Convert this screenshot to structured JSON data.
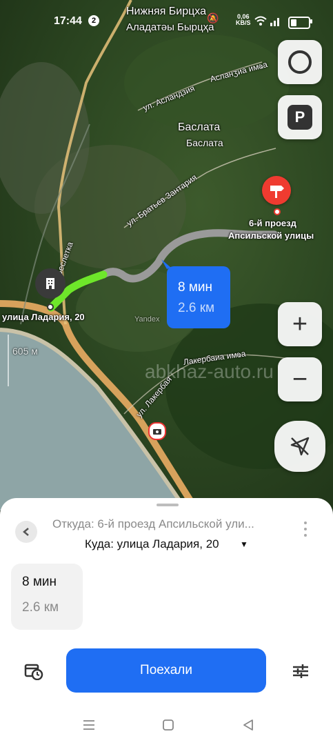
{
  "status_bar": {
    "time": "17:44",
    "notification_count": "2",
    "speed_value": "0,06",
    "speed_unit": "KB/S"
  },
  "map": {
    "place_top_ru": "Нижняя Бирцха",
    "place_top_ab": "Аладатәы Бырцҳа",
    "village_ru": "Баслата",
    "village_ab": "Баслата",
    "street_aslandzia": "ул. Асландзия",
    "street_aslandzia_ab": "Асланӡиа имҩа",
    "street_brothers": "ул. Братьев Зантария",
    "river_besletka": "р. Беслетка",
    "street_lakerbaia": "ул. Лакербая",
    "street_lakerbaia_ab": "Лакербаиа имҩа",
    "yandex_label": "Yandex",
    "watermark": "abkhaz-auto.ru",
    "scale_label": "605 м",
    "destination_label_1": "6-й проезд",
    "destination_label_2": "Апсильской улицы",
    "origin_label": "улица Ладария, 20",
    "route_bubble": {
      "time": "8 мин",
      "distance": "2.6 км"
    },
    "route_color_traffic_free": "#6ee62a",
    "route_color_main": "#9a9a9a"
  },
  "controls": {
    "parking_label": "P",
    "zoom_in": "+",
    "zoom_out": "−"
  },
  "sheet": {
    "from_text": "Откуда: 6-й проезд Апсильской ули...",
    "to_text": "Куда: улица Ладария, 20",
    "route_card": {
      "time": "8 мин",
      "distance": "2.6 км"
    },
    "go_button": "Поехали",
    "accent": "#1f6ef3"
  }
}
